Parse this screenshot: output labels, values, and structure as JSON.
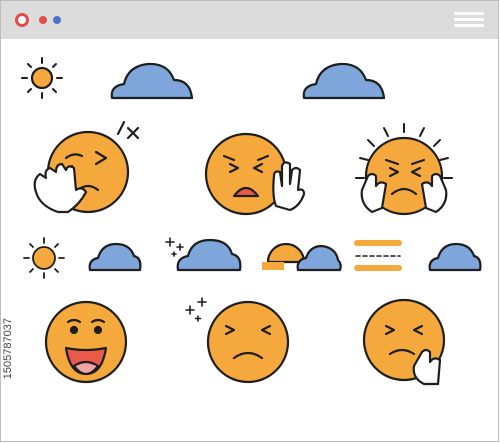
{
  "window": {
    "title_bar_colors": {
      "bar": "#dcdcdc",
      "close": "#e64a4a",
      "minimize": "#e64a4a",
      "maximize": "#4a74c9"
    }
  },
  "colors": {
    "face": "#f5a93c",
    "outline": "#1e1e1e",
    "cloud": "#7ea6da",
    "hand": "#ffffff",
    "mouth": "#e85a4a",
    "tongue": "#f3a4a4"
  },
  "icons": [
    "sun-icon",
    "cloud-icon",
    "face-icon",
    "hand-icon",
    "sparkle-icon",
    "menu-icon"
  ],
  "stock_id": "1505787037"
}
